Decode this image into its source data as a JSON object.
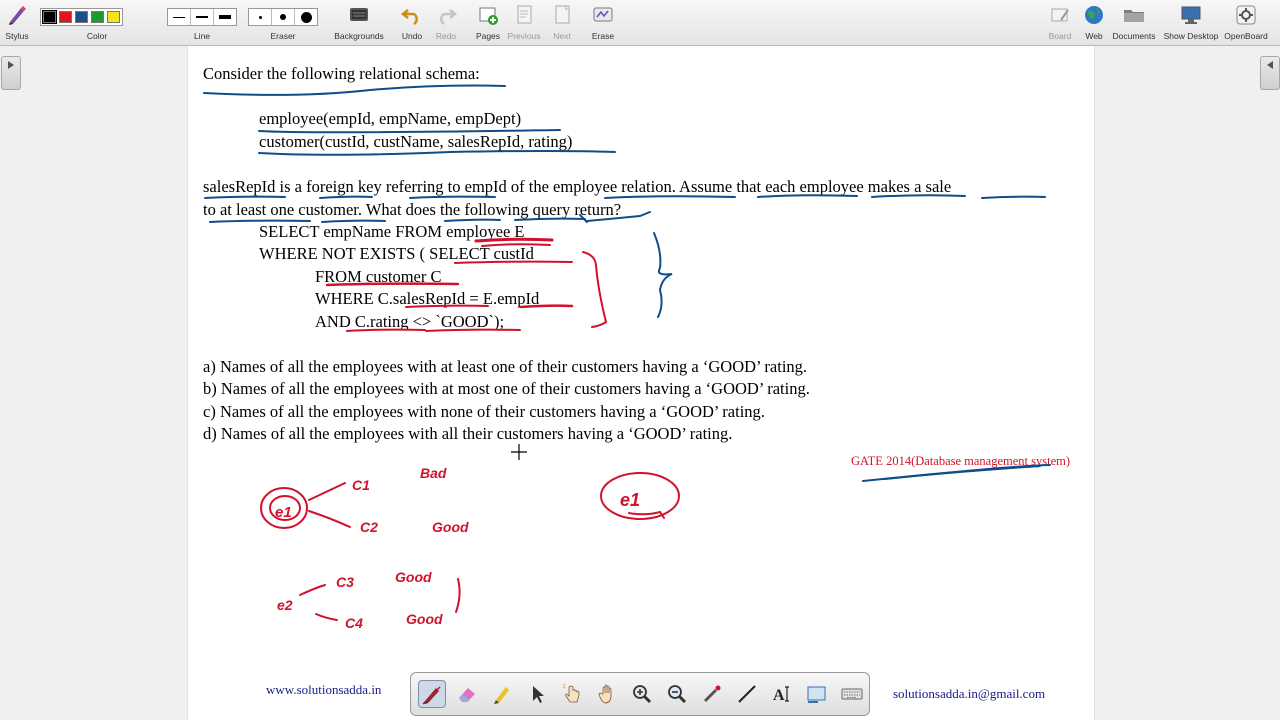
{
  "toolbar": {
    "stylus": "Stylus",
    "color": "Color",
    "line": "Line",
    "eraser": "Eraser",
    "backgrounds": "Backgrounds",
    "undo": "Undo",
    "redo": "Redo",
    "pages": "Pages",
    "previous": "Previous",
    "next": "Next",
    "erase": "Erase",
    "board": "Board",
    "web": "Web",
    "documents": "Documents",
    "show_desktop": "Show Desktop",
    "openboard": "OpenBoard",
    "colors": [
      "#000000",
      "#e0141c",
      "#1a4f8c",
      "#1d9a2f",
      "#f6e21b"
    ]
  },
  "doc": {
    "intro": "Consider the following relational schema:",
    "schema1": "employee(empId, empName, empDept)",
    "schema2": "customer(custId, custName, salesRepId, rating)",
    "para1": "salesRepId is a foreign key referring to empId of the employee relation. Assume that each employee makes a sale",
    "para2": "to at least one customer. What does the following query return?",
    "q1": "SELECT empName FROM employee E",
    "q2": "WHERE NOT EXISTS ( SELECT custId",
    "q3": "FROM customer C",
    "q4": "WHERE C.salesRepId = E.empId",
    "q5": "AND C.rating <> `GOOD`);",
    "opt_a": "a) Names of all the employees with at least one of their customers having a ‘GOOD’ rating.",
    "opt_b": "b) Names of all the employees with at most one of their customers having a ‘GOOD’ rating.",
    "opt_c": "c) Names of all the employees with none of their customers having a ‘GOOD’ rating.",
    "opt_d": "d) Names of all the employees with all their customers having a ‘GOOD’ rating.",
    "gate": "GATE 2014(Database management system)"
  },
  "footer": {
    "left": "www.solutionsadda.in",
    "right": "solutionsadda.in@gmail.com"
  },
  "annotations": {
    "e1": "e1",
    "c1": "C1",
    "c2": "C2",
    "bad": "Bad",
    "good1": "Good",
    "e2": "e2",
    "c3": "C3",
    "c4": "C4",
    "good2": "Good",
    "good3": "Good",
    "e1b": "e1"
  },
  "colors": {
    "ink_red": "#d1122a",
    "ink_blue": "#0f4d8a"
  }
}
